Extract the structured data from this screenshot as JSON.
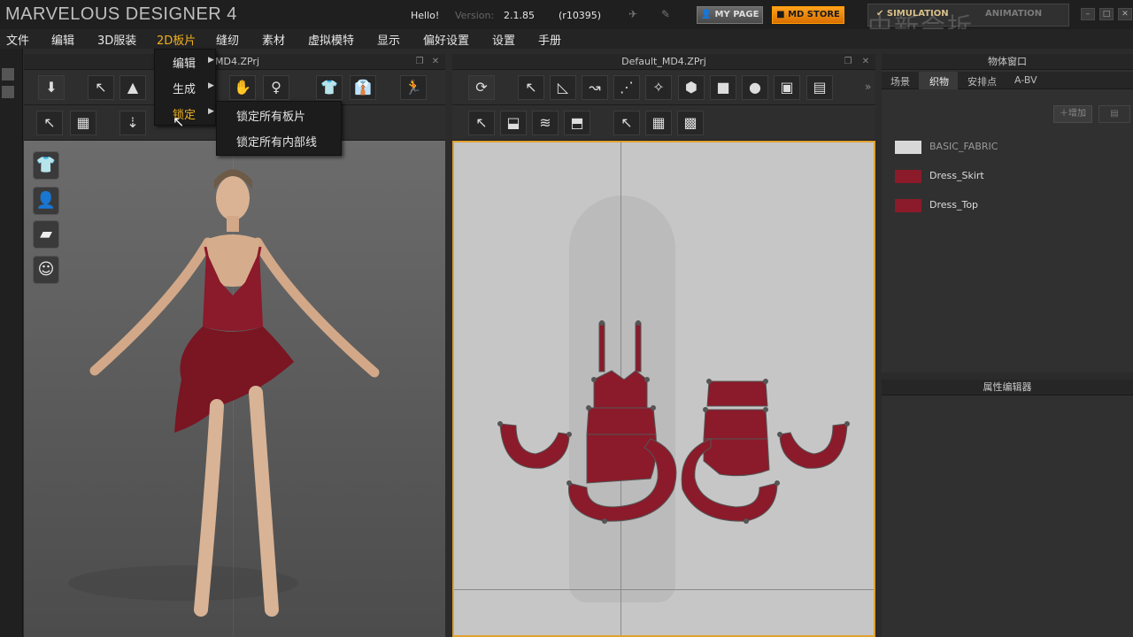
{
  "titlebar": {
    "app_title": "MARVELOUS DESIGNER 4",
    "hello": "Hello!",
    "version_label": "Version:",
    "version_number": "2.1.85",
    "revision": "(r10395)",
    "my_page": "MY PAGE",
    "md_store": "MD STORE",
    "simulation_tab": "SIMULATION",
    "animation_tab": "ANIMATION",
    "watermark": "中新会拆"
  },
  "menubar": {
    "items": [
      "文件",
      "编辑",
      "3D服装",
      "2D板片",
      "缝纫",
      "素材",
      "虚拟模特",
      "显示",
      "偏好设置",
      "设置",
      "手册"
    ]
  },
  "dropdown": {
    "items": [
      "编辑",
      "生成",
      "锁定"
    ],
    "submenu": [
      "锁定所有板片",
      "锁定所有内部线"
    ]
  },
  "window3d": {
    "title": "MD4.ZPrj"
  },
  "window2d": {
    "title": "Default_MD4.ZPrj"
  },
  "object_window": {
    "title": "物体窗口",
    "tabs": [
      "场景",
      "织物",
      "安排点",
      "A-BV"
    ],
    "add_label": "增加",
    "fabrics": [
      {
        "name": "BASIC_FABRIC",
        "color": "#d8d8d8"
      },
      {
        "name": "Dress_Skirt",
        "color": "#8b1a2a"
      },
      {
        "name": "Dress_Top",
        "color": "#8b1a2a"
      }
    ]
  },
  "property_window": {
    "title": "属性编辑器"
  },
  "colors": {
    "garment": "#8b1a2a",
    "menu_active": "#f0b020",
    "store_orange": "#f08c00"
  }
}
